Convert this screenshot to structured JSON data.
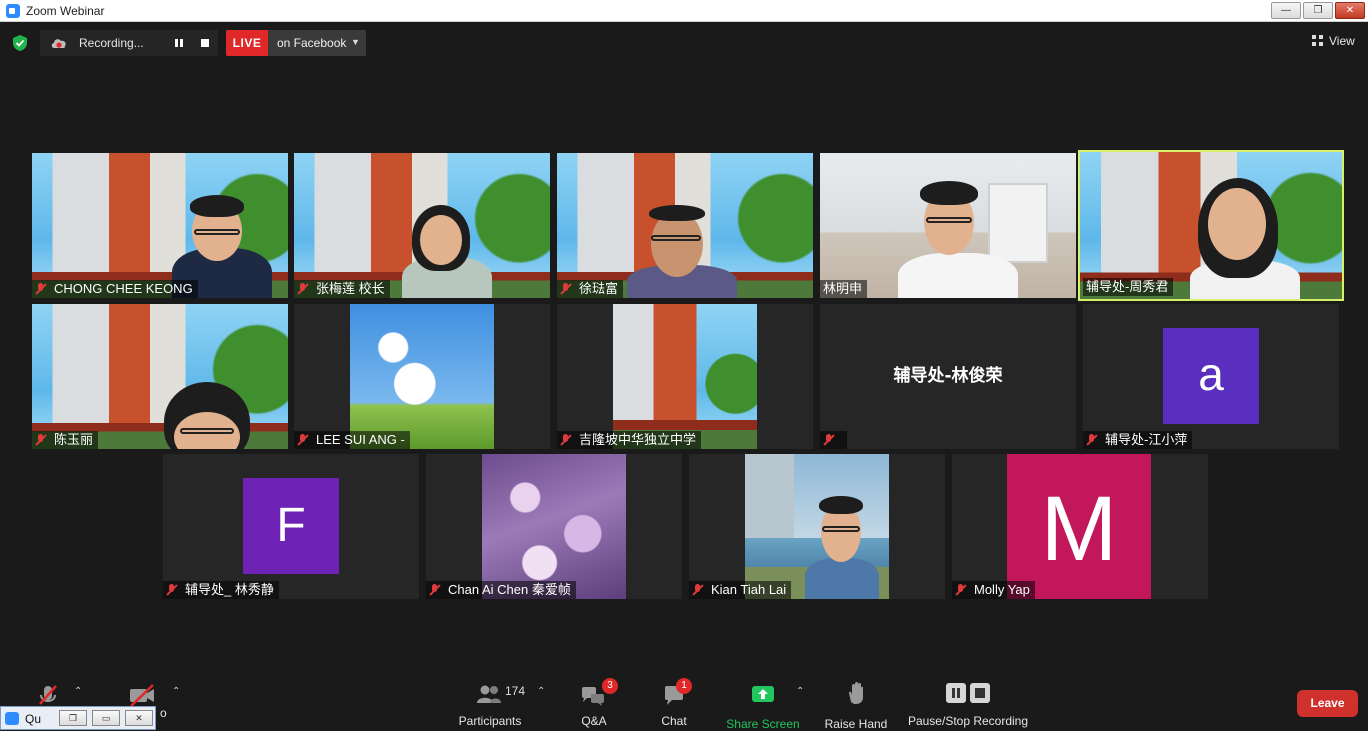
{
  "window": {
    "title": "Zoom Webinar",
    "buttons": [
      "—",
      "❐",
      "✕"
    ]
  },
  "topbar": {
    "recording_text": "Recording...",
    "live_tag": "LIVE",
    "live_destination": "on Facebook",
    "view_label": "View"
  },
  "participants": [
    {
      "name": "CHONG CHEE KEONG",
      "muted": true
    },
    {
      "name": "张梅莲 校长",
      "muted": true
    },
    {
      "name": "徐琺富",
      "muted": true
    },
    {
      "name": "林明申",
      "muted": false
    },
    {
      "name": "辅导处-周秀君",
      "muted": false,
      "active_speaker": true
    },
    {
      "name": "陈玉丽",
      "muted": true
    },
    {
      "name": "LEE SUI ANG -",
      "muted": true
    },
    {
      "name": "吉隆坡中华独立中学",
      "muted": true
    },
    {
      "name": "",
      "muted": true,
      "center_name": "辅导处-林俊荣"
    },
    {
      "name": "辅导处-江小萍",
      "muted": true,
      "avatar_letter": "a",
      "avatar_color": "#5a2fc0"
    },
    {
      "name": "辅导处_ 林秀静",
      "muted": true,
      "avatar_letter": "F",
      "avatar_color": "#6f22b6"
    },
    {
      "name": "Chan Ai Chen 秦爱帧",
      "muted": true
    },
    {
      "name": "Kian Tiah Lai",
      "muted": true
    },
    {
      "name": "Molly Yap",
      "muted": true,
      "avatar_letter": "M",
      "avatar_color": "#c2185b"
    }
  ],
  "toolbar": {
    "participants_count": "174",
    "participants_label": "Participants",
    "qa_label": "Q&A",
    "qa_badge": "3",
    "chat_label": "Chat",
    "chat_badge": "1",
    "share_label": "Share Screen",
    "raise_label": "Raise Hand",
    "recording_label": "Pause/Stop Recording",
    "video_label_partial": "o",
    "leave_label": "Leave",
    "accent_green": "#22c55e",
    "leave_color": "#d0312d"
  },
  "mini_window": {
    "label": "Qu"
  }
}
